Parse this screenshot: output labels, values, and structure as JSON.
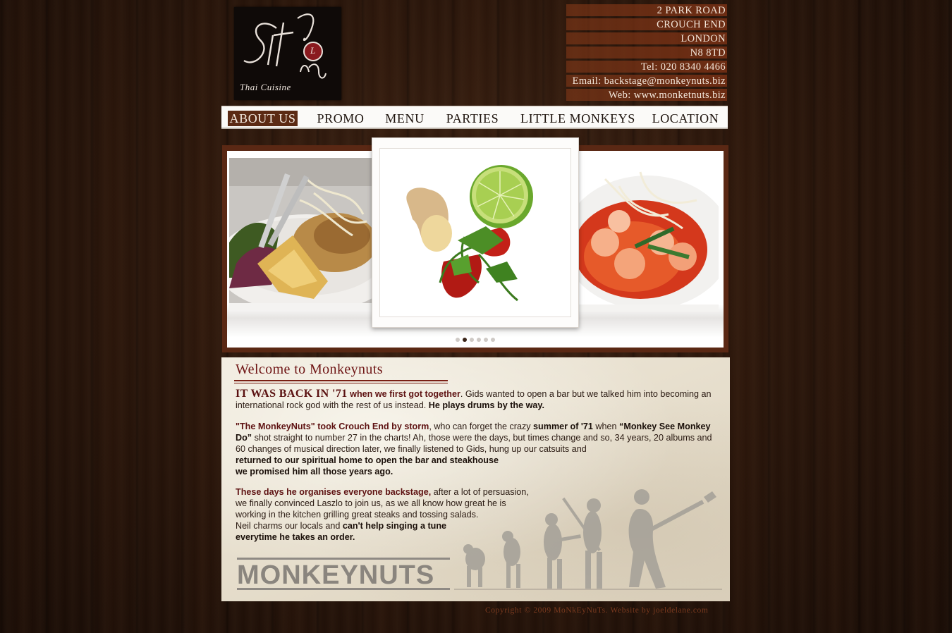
{
  "brand": {
    "logo_text": "Sitoney",
    "logo_tagline": "Thai Cuisine",
    "logo_letter": "L"
  },
  "address": {
    "lines": [
      "2 PARK ROAD",
      "CROUCH END",
      "LONDON",
      "N8 8TD",
      "Tel: 020 8340 4466",
      "Email: backstage@monkeynuts.biz",
      "Web: www.monketnuts.biz"
    ]
  },
  "nav": {
    "items": [
      {
        "label": "ABOUT US",
        "active": true
      },
      {
        "label": "PROMO",
        "active": false
      },
      {
        "label": "MENU",
        "active": false
      },
      {
        "label": "PARTIES",
        "active": false
      },
      {
        "label": "LITTLE MONKEYS",
        "active": false
      },
      {
        "label": "LOCATION",
        "active": false
      }
    ]
  },
  "slider": {
    "slide_count": 6,
    "active_index": 1
  },
  "content": {
    "title": "Welcome to Monkeynuts",
    "p1": {
      "lead": "IT WAS BACK IN '71",
      "lead2": " when we first got together",
      "text": ". Gids wanted to open a bar but we talked him into becoming an international rock god with the rest of us instead. ",
      "bold": "He plays drums by the way."
    },
    "p2": {
      "lead": "\"The MonkeyNuts\" took Crouch End by storm",
      "t1": ", who can forget the crazy ",
      "b1": "summer of '71",
      "t2": " when ",
      "b2": "“Monkey See Monkey Do”",
      "t3": " shot straight to number 27 in the charts! Ah, those were the days, but times change and so, 34 years, 20 albums and 60 changes of musical direction later, we finally listened to Gids, hung up our catsuits and ",
      "b3": "returned to our spiritual home to open the bar and steakhouse",
      "b4": "we promised him all those years ago."
    },
    "p3": {
      "lead": "These days he organises everyone backstage,",
      "t1": " after a lot of persuasion,",
      "t2": "we finally convinced Laszlo to join us, as we all know how great he is",
      "t3": "working in the kitchen grilling great steaks and tossing salads.",
      "t4": "Neil charms our locals and ",
      "b1": "can't help singing a tune",
      "b2": "everytime he takes an order."
    },
    "band_logo": "MONKEYNUTS"
  },
  "footer": {
    "copyright": "Copyright © 2009 MoNkEyNuTs. Website by joeldelane.com"
  },
  "colors": {
    "accent": "#5b2a14",
    "heading": "#6e1414",
    "paper": "#e8e0cf"
  }
}
